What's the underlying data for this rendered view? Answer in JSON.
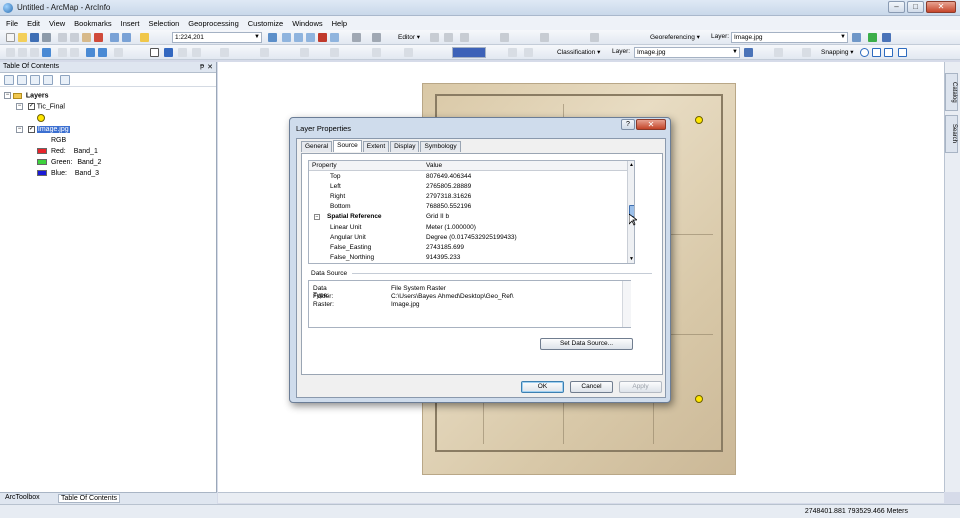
{
  "window": {
    "title": "Untitled - ArcMap - ArcInfo",
    "minimize": "–",
    "maximize": "□",
    "close": "✕"
  },
  "menu": [
    "File",
    "Edit",
    "View",
    "Bookmarks",
    "Insert",
    "Selection",
    "Geoprocessing",
    "Customize",
    "Windows",
    "Help"
  ],
  "toolbar": {
    "scale": "1:224,201",
    "editor_label": "Editor ▾",
    "georef_label": "Georeferencing ▾",
    "georef_layer_label": "Layer:",
    "georef_layer_value": "Image.jpg",
    "classification_label": "Classification ▾",
    "class_layer_label": "Layer:",
    "class_layer_value": "Image.jpg",
    "snapping_label": "Snapping ▾"
  },
  "toc": {
    "title": "Table Of Contents",
    "pin": "ᵽ",
    "close": "✕",
    "root": "Layers",
    "layer1": "Tic_Final",
    "layer2": "Image.jpg",
    "rgb": "RGB",
    "bands": [
      {
        "label": "Red:",
        "value": "Band_1",
        "color": "#e8242b"
      },
      {
        "label": "Green:",
        "value": "Band_2",
        "color": "#3dd23d"
      },
      {
        "label": "Blue:",
        "value": "Band_3",
        "color": "#1a1ad6"
      }
    ],
    "bottom_tabs": [
      "ArcToolbox",
      "Table Of Contents"
    ]
  },
  "side_tabs": [
    "Catalog",
    "Search"
  ],
  "status": {
    "coords": "2748401.881  793529.466 Meters"
  },
  "dialog": {
    "title": "Layer Properties",
    "help": "?",
    "close": "✕",
    "tabs": [
      "General",
      "Source",
      "Extent",
      "Display",
      "Symbology"
    ],
    "active_tab": "Source",
    "grid_headers": {
      "property": "Property",
      "value": "Value"
    },
    "rows": [
      {
        "key": "Top",
        "value": "807649.406344"
      },
      {
        "key": "Left",
        "value": "2765805.28889"
      },
      {
        "key": "Right",
        "value": "2797318.31626"
      },
      {
        "key": "Bottom",
        "value": "768850.552196"
      }
    ],
    "group": {
      "key": "Spatial Reference",
      "value": "Grid II b"
    },
    "sr_rows": [
      {
        "key": "Linear Unit",
        "value": "Meter (1.000000)"
      },
      {
        "key": "Angular Unit",
        "value": "Degree (0.0174532925199433)"
      },
      {
        "key": "False_Easting",
        "value": "2743185.699"
      },
      {
        "key": "False_Northing",
        "value": "914395.233"
      }
    ],
    "data_source_label": "Data Source",
    "data_source": [
      {
        "key": "Data Type:",
        "value": "File System Raster"
      },
      {
        "key": "Folder:",
        "value": "C:\\Users\\Bayes Ahmed\\Desktop\\Geo_Ref\\"
      },
      {
        "key": "Raster:",
        "value": "Image.jpg"
      }
    ],
    "set_source_button": "Set Data Source...",
    "ok": "OK",
    "cancel": "Cancel",
    "apply": "Apply"
  }
}
